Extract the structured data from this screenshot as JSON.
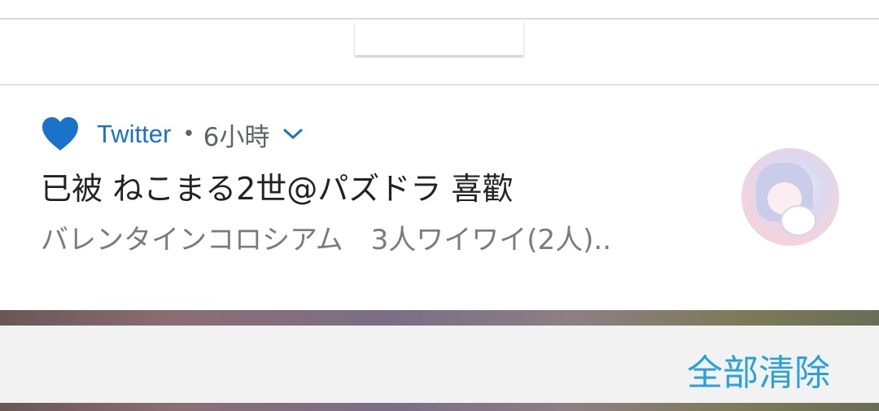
{
  "notification": {
    "app_name": "Twitter",
    "separator": "•",
    "time": "6小時",
    "title": "已被 ねこまる2世@パズドラ 喜歡",
    "body": "バレンタインコロシアム　3人ワイワイ(2人)..",
    "app_icon": "heart-icon",
    "accent_color": "#1a73c9"
  },
  "footer": {
    "clear_all_label": "全部清除",
    "clear_all_color": "#2aa2d9"
  }
}
